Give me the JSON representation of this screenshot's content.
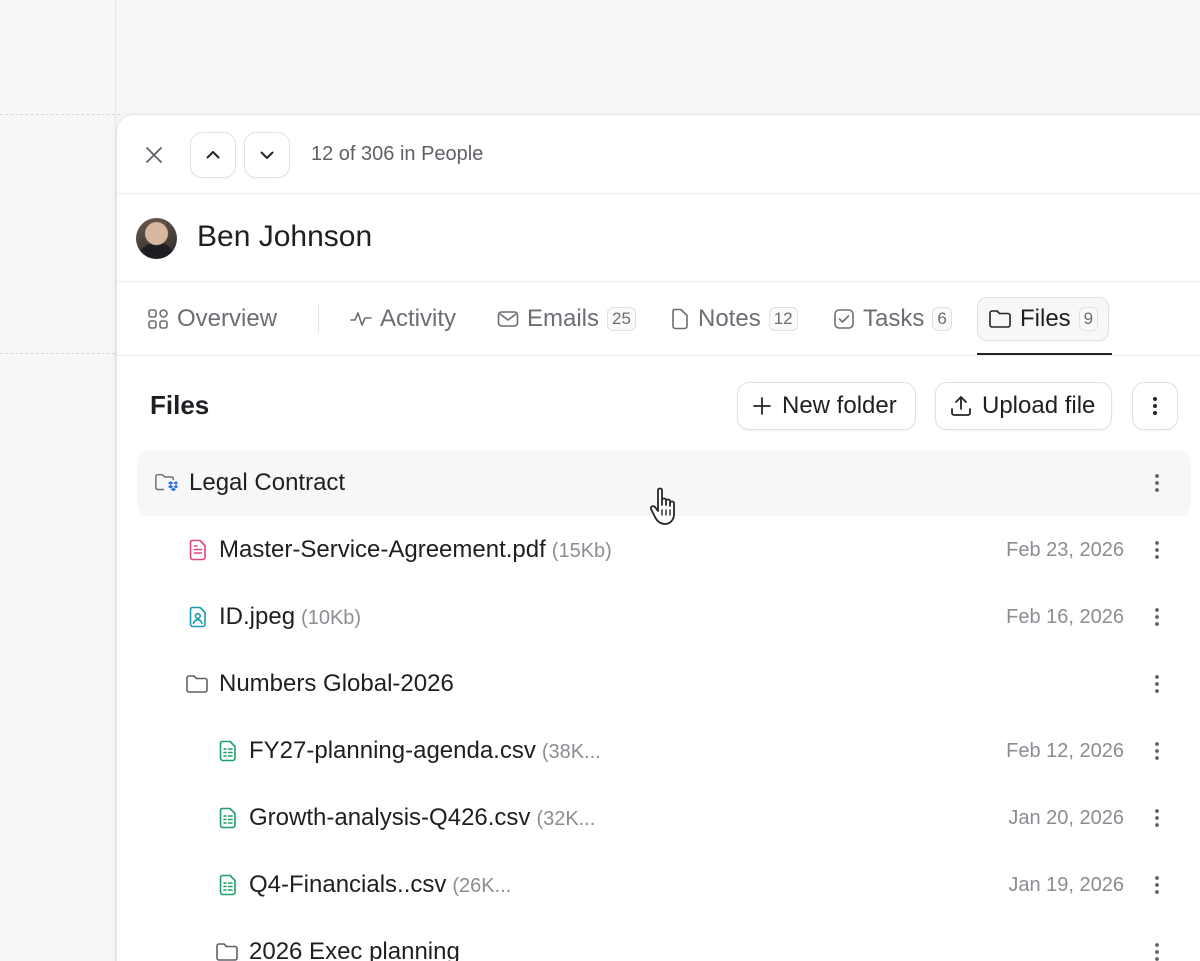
{
  "header": {
    "counter": "12 of 306 in People"
  },
  "person": {
    "name": "Ben Johnson"
  },
  "tabs": [
    {
      "label": "Overview",
      "badge": null,
      "icon": "grid-icon"
    },
    {
      "label": "Activity",
      "badge": null,
      "icon": "activity-icon"
    },
    {
      "label": "Emails",
      "badge": "25",
      "icon": "mail-icon"
    },
    {
      "label": "Notes",
      "badge": "12",
      "icon": "note-icon"
    },
    {
      "label": "Tasks",
      "badge": "6",
      "icon": "checkbox-icon"
    },
    {
      "label": "Files",
      "badge": "9",
      "icon": "folder-icon",
      "active": true
    }
  ],
  "files_section": {
    "title": "Files",
    "new_folder_label": "New folder",
    "upload_label": "Upload file"
  },
  "rows": [
    {
      "name": "Legal Contract",
      "size": "",
      "date": "",
      "type": "dropbox-folder",
      "level": 0
    },
    {
      "name": "Master-Service-Agreement.pdf",
      "size": "(15Kb)",
      "date": "Feb 23, 2026",
      "type": "pdf",
      "level": 1
    },
    {
      "name": "ID.jpeg",
      "size": "(10Kb)",
      "date": "Feb 16, 2026",
      "type": "image",
      "level": 1
    },
    {
      "name": "Numbers Global-2026",
      "size": "",
      "date": "",
      "type": "folder",
      "level": 1
    },
    {
      "name": "FY27-planning-agenda.csv",
      "size": "(38K...",
      "date": "Feb 12, 2026",
      "type": "csv",
      "level": 2
    },
    {
      "name": "Growth-analysis-Q426.csv",
      "size": "(32K...",
      "date": "Jan 20, 2026",
      "type": "csv",
      "level": 2
    },
    {
      "name": "Q4-Financials..csv",
      "size": "(26K...",
      "date": "Jan 19, 2026",
      "type": "csv",
      "level": 2
    },
    {
      "name": "2026 Exec planning",
      "size": "",
      "date": "",
      "type": "folder",
      "level": 2
    }
  ],
  "colors": {
    "pdf": "#e0457b",
    "image": "#1a9bb0",
    "csv": "#1f9d6b",
    "dropbox": "#2f6fe4"
  }
}
